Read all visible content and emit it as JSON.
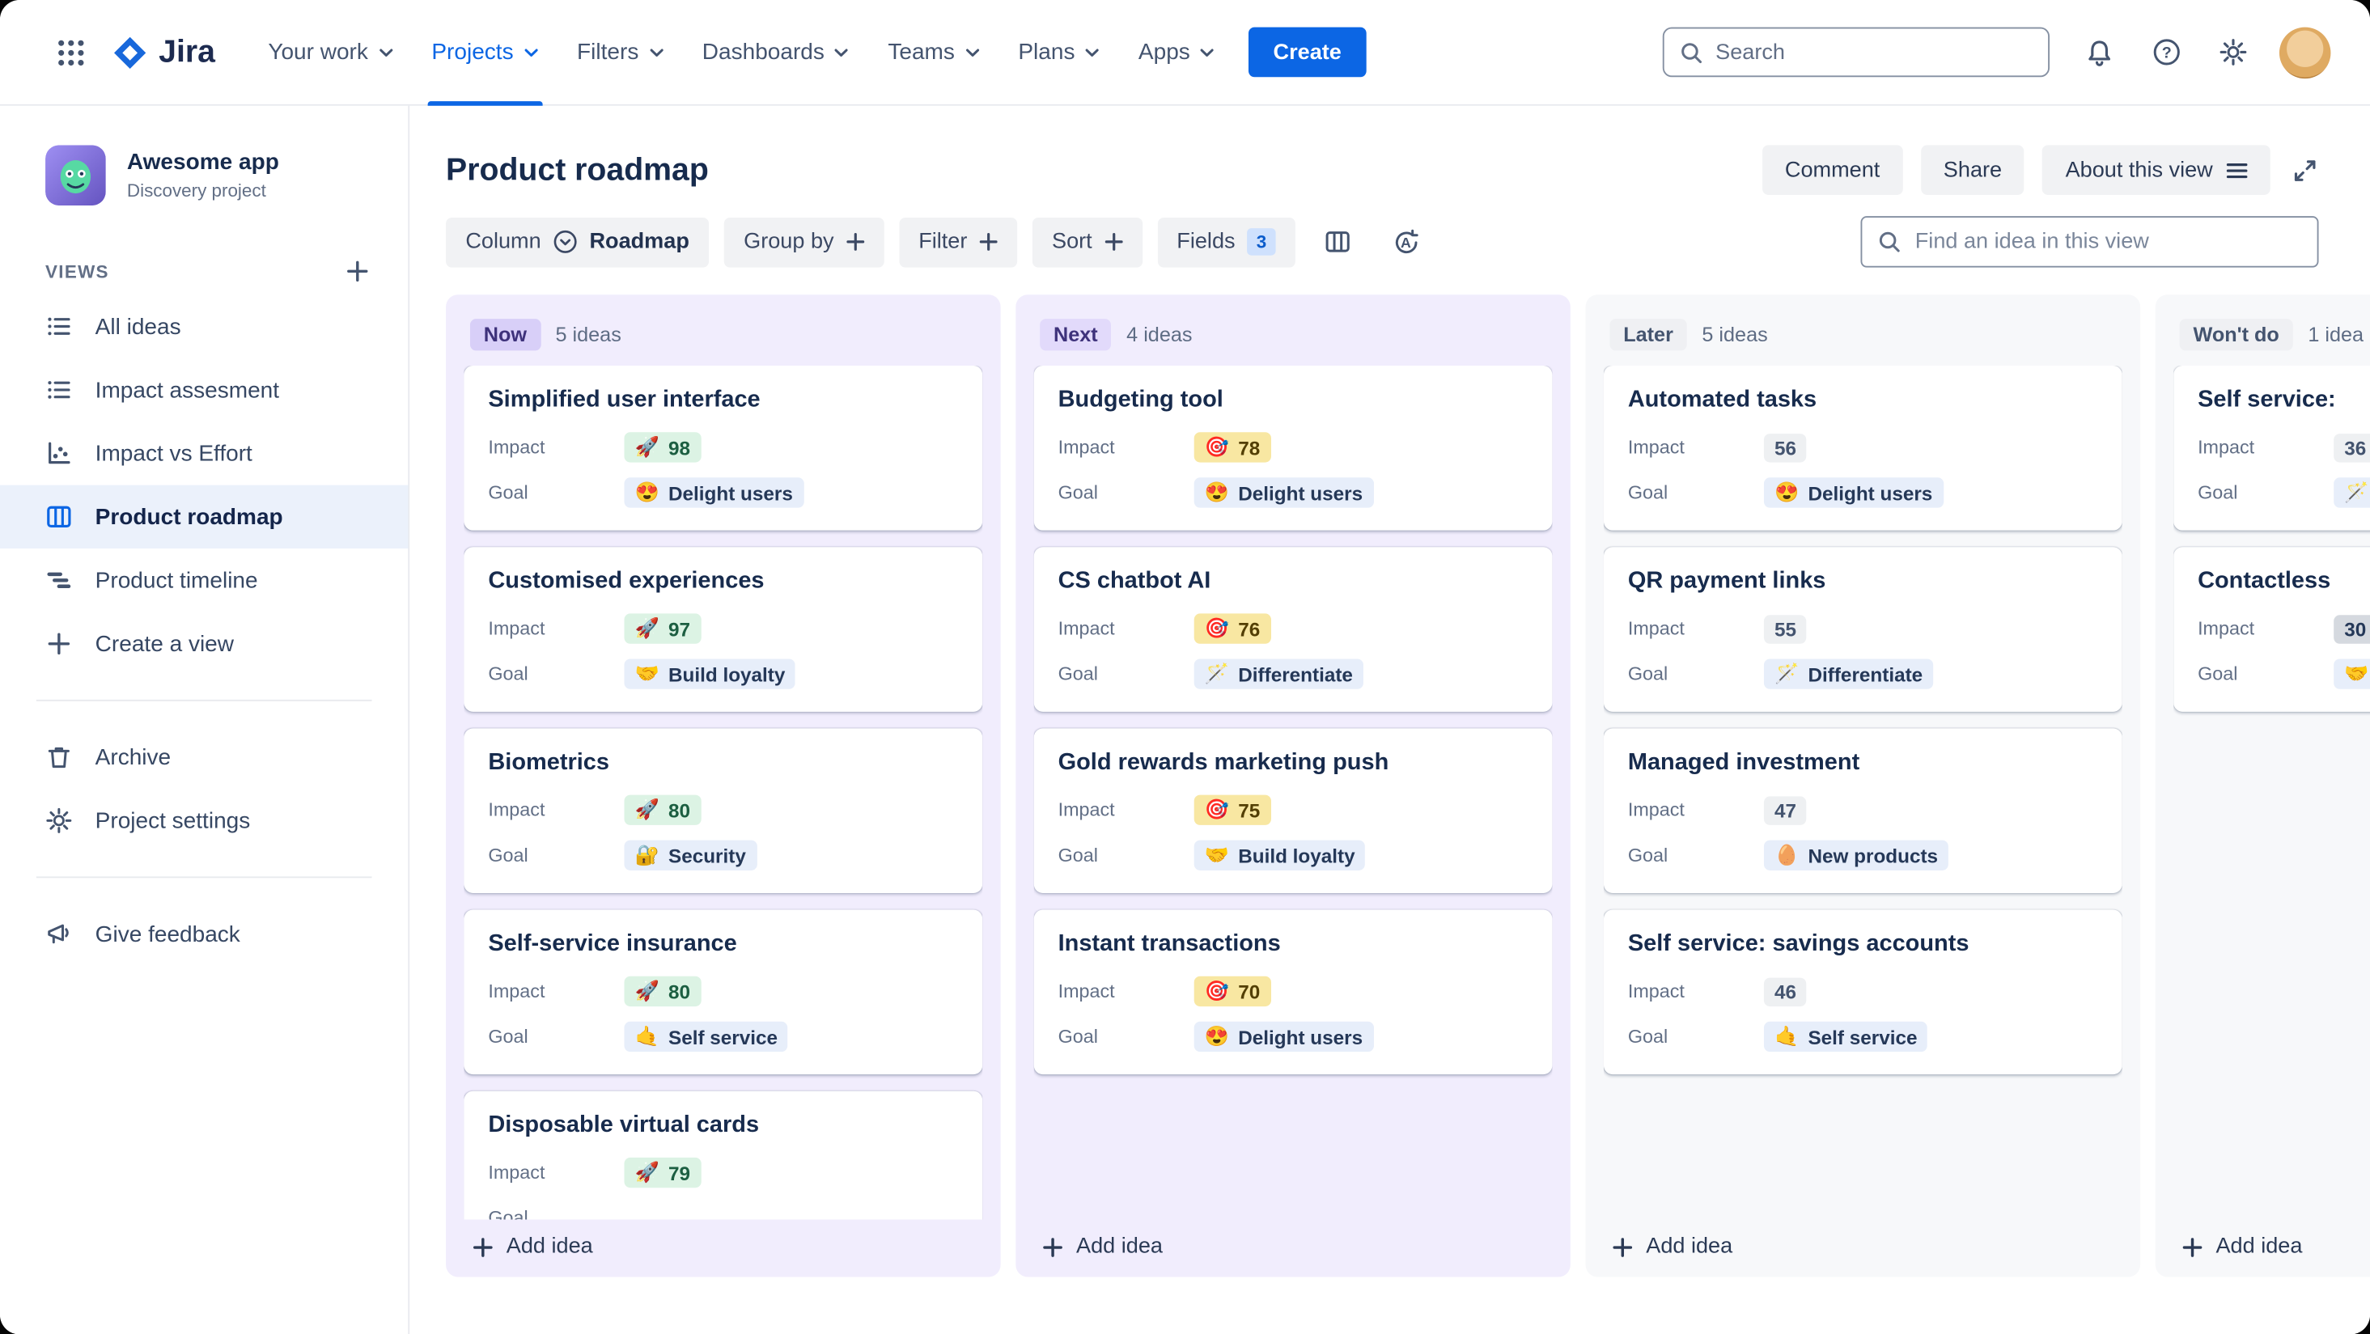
{
  "colors": {
    "accent_blue": "#0C66E4",
    "brand_logo_blue": "#1868DB",
    "purple_column_bg": "#F1EDFD",
    "neutral_column_bg": "#F7F8FA",
    "now_badge_bg": "#D8CFF8",
    "next_badge_bg": "#E2DAFB",
    "later_badge_bg": "#EFF0F3",
    "impact_green_bg": "#DCF3E4",
    "impact_yellow_bg": "#F8E7A2",
    "impact_gray_bg": "#EEF0F2",
    "goal_badge_bg": "#E7EEFA"
  },
  "topbar": {
    "logo_text": "Jira",
    "nav": [
      "Your work",
      "Projects",
      "Filters",
      "Dashboards",
      "Teams",
      "Plans",
      "Apps"
    ],
    "create_label": "Create",
    "search_placeholder": "Search"
  },
  "sidebar": {
    "project_name": "Awesome app",
    "project_type": "Discovery project",
    "views_label": "VIEWS",
    "items": [
      "All ideas",
      "Impact assesment",
      "Impact vs Effort",
      "Product roadmap",
      "Product timeline",
      "Create a view"
    ],
    "archive_label": "Archive",
    "settings_label": "Project settings",
    "feedback_label": "Give feedback"
  },
  "header": {
    "title": "Product roadmap",
    "comment_label": "Comment",
    "share_label": "Share",
    "about_label": "About this view"
  },
  "toolbar": {
    "column_label": "Column",
    "column_value": "Roadmap",
    "group_by_label": "Group by",
    "filter_label": "Filter",
    "sort_label": "Sort",
    "fields_label": "Fields",
    "fields_count": "3",
    "find_placeholder": "Find an idea in this view"
  },
  "board": {
    "impact_label": "Impact",
    "goal_label": "Goal",
    "add_idea_label": "Add idea",
    "columns": [
      {
        "name": "Now",
        "count": "5 ideas",
        "theme": "purple",
        "badge": "now",
        "cards": [
          {
            "title": "Simplified user interface",
            "impact_emoji": "🚀",
            "impact": "98",
            "impact_theme": "green",
            "goal_emoji": "😍",
            "goal": "Delight users"
          },
          {
            "title": "Customised experiences",
            "impact_emoji": "🚀",
            "impact": "97",
            "impact_theme": "green",
            "goal_emoji": "🤝",
            "goal": "Build loyalty"
          },
          {
            "title": "Biometrics",
            "impact_emoji": "🚀",
            "impact": "80",
            "impact_theme": "green",
            "goal_emoji": "🔐",
            "goal": "Security"
          },
          {
            "title": "Self-service insurance",
            "impact_emoji": "🚀",
            "impact": "80",
            "impact_theme": "green",
            "goal_emoji": "🤙",
            "goal": "Self service"
          },
          {
            "title": "Disposable virtual cards",
            "impact_emoji": "🚀",
            "impact": "79",
            "impact_theme": "green",
            "goal_emoji": "",
            "goal": ""
          }
        ]
      },
      {
        "name": "Next",
        "count": "4 ideas",
        "theme": "purple",
        "badge": "next",
        "cards": [
          {
            "title": "Budgeting tool",
            "impact_emoji": "🎯",
            "impact": "78",
            "impact_theme": "yellow",
            "goal_emoji": "😍",
            "goal": "Delight users"
          },
          {
            "title": "CS chatbot AI",
            "impact_emoji": "🎯",
            "impact": "76",
            "impact_theme": "yellow",
            "goal_emoji": "🪄",
            "goal": "Differentiate"
          },
          {
            "title": "Gold rewards marketing push",
            "impact_emoji": "🎯",
            "impact": "75",
            "impact_theme": "yellow",
            "goal_emoji": "🤝",
            "goal": "Build loyalty"
          },
          {
            "title": "Instant transactions",
            "impact_emoji": "🎯",
            "impact": "70",
            "impact_theme": "yellow",
            "goal_emoji": "😍",
            "goal": "Delight users"
          }
        ]
      },
      {
        "name": "Later",
        "count": "5 ideas",
        "theme": "neutral",
        "badge": "later",
        "cards": [
          {
            "title": "Automated tasks",
            "impact_emoji": "",
            "impact": "56",
            "impact_theme": "gray",
            "goal_emoji": "😍",
            "goal": "Delight users"
          },
          {
            "title": "QR payment links",
            "impact_emoji": "",
            "impact": "55",
            "impact_theme": "gray",
            "goal_emoji": "🪄",
            "goal": "Differentiate"
          },
          {
            "title": "Managed investment",
            "impact_emoji": "",
            "impact": "47",
            "impact_theme": "gray",
            "goal_emoji": "🥚",
            "goal": "New products"
          },
          {
            "title": "Self service: savings accounts",
            "impact_emoji": "",
            "impact": "46",
            "impact_theme": "gray",
            "goal_emoji": "🤙",
            "goal": "Self service"
          }
        ]
      },
      {
        "name": "Won't do",
        "count": "1 idea",
        "theme": "neutral",
        "badge": "later",
        "cards": [
          {
            "title": "Self service:",
            "impact_emoji": "",
            "impact": "36",
            "impact_theme": "gray",
            "goal_emoji": "🪄",
            "goal": ""
          },
          {
            "title": "Contactless",
            "impact_emoji": "",
            "impact": "30",
            "impact_theme": "darkgray",
            "goal_emoji": "🤝",
            "goal": ""
          }
        ]
      }
    ]
  }
}
